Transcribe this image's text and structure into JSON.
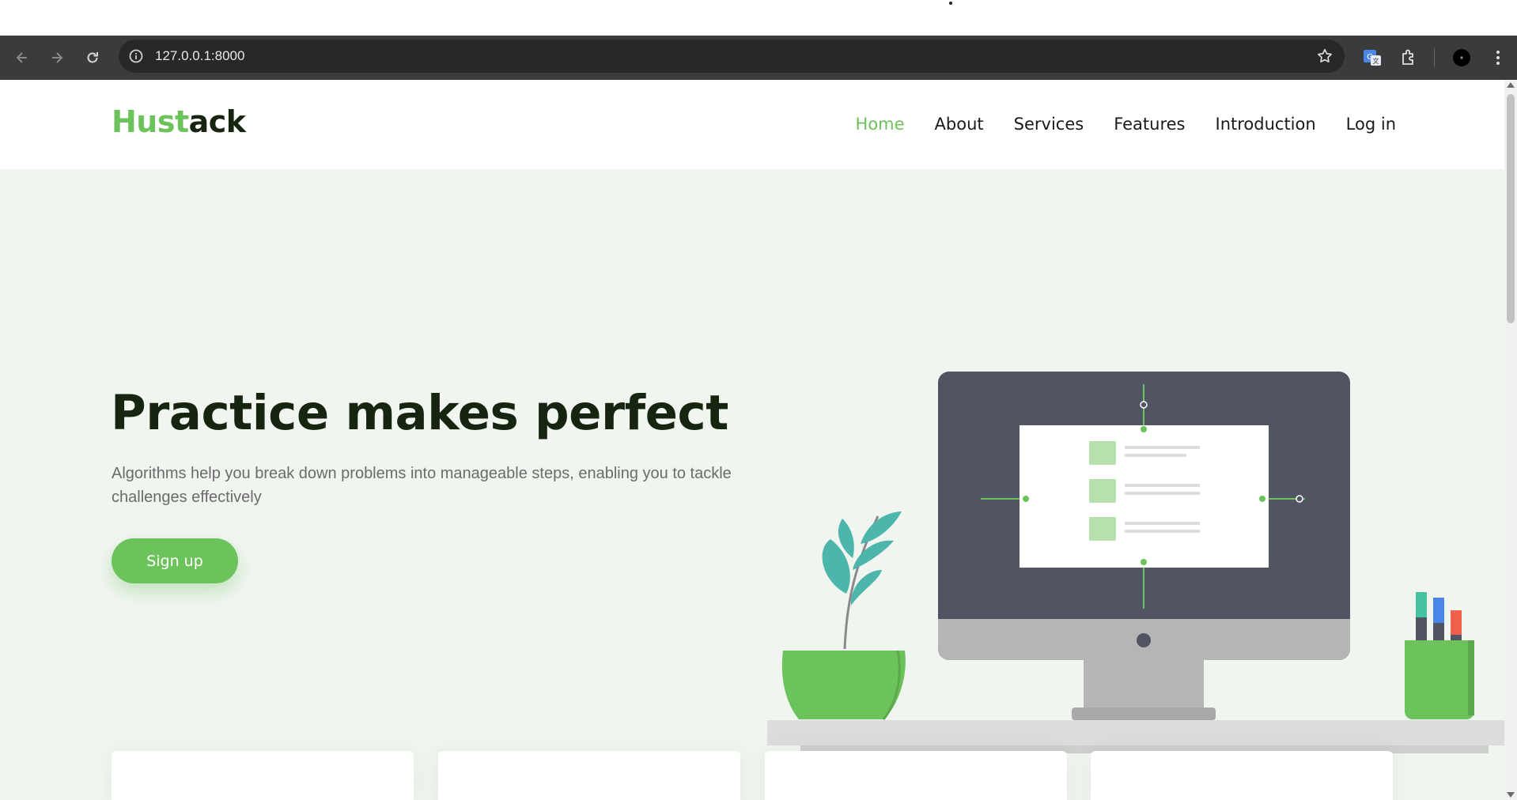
{
  "browser": {
    "url": "127.0.0.1:8000"
  },
  "site": {
    "logo": {
      "part1": "Hust",
      "part2": "ack"
    },
    "nav": [
      {
        "label": "Home",
        "active": true
      },
      {
        "label": "About"
      },
      {
        "label": "Services"
      },
      {
        "label": "Features"
      },
      {
        "label": "Introduction"
      },
      {
        "label": "Log in"
      }
    ]
  },
  "hero": {
    "title": "Practice makes perfect",
    "subtitle": "Algorithms help you break down problems into manageable steps, enabling you to tackle challenges effectively",
    "cta_label": "Sign up"
  },
  "icons": [
    "back-arrow-icon",
    "forward-arrow-icon",
    "reload-icon",
    "info-icon",
    "star-icon",
    "translate-icon",
    "extensions-icon",
    "profile-avatar-icon",
    "menu-kebab-icon"
  ],
  "colors": {
    "brand": "#6cc25b",
    "dark": "#17240f",
    "hero_bg": "#f0f5f0"
  }
}
